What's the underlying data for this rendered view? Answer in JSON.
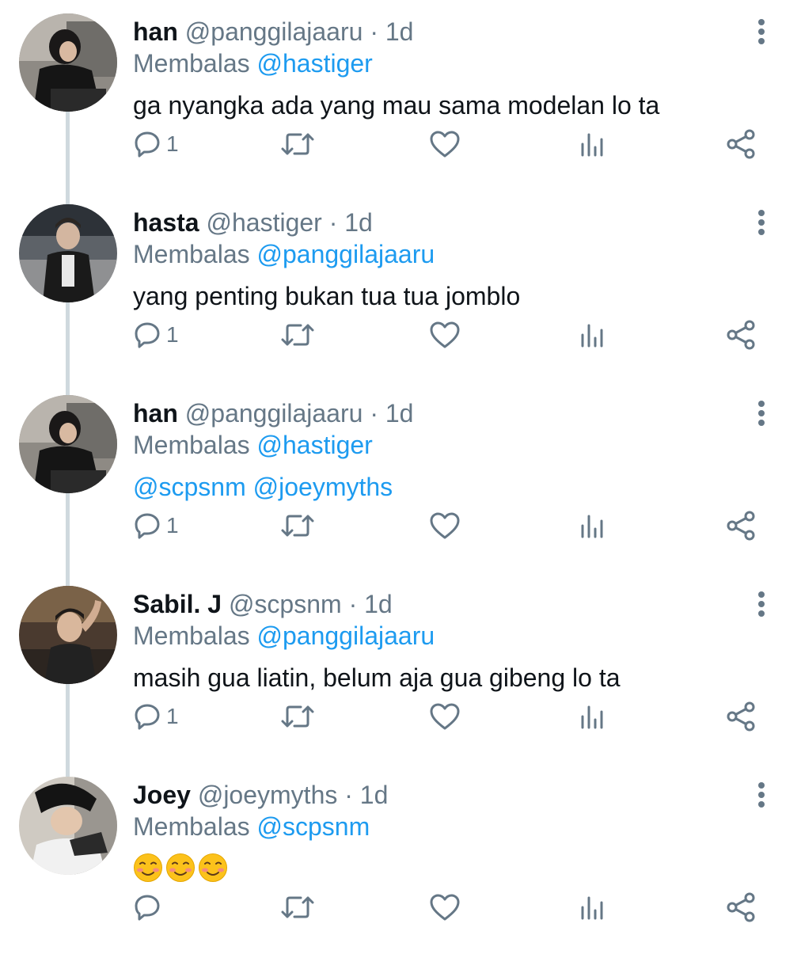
{
  "thread": {
    "replying_prefix": "Membalas",
    "tweets": [
      {
        "display_name": "han",
        "handle": "@panggilajaaru",
        "separator": "·",
        "time": "1d",
        "replying_to": "@hastiger",
        "text": "ga nyangka ada yang mau sama modelan lo ta",
        "reply_count": "1"
      },
      {
        "display_name": "hasta",
        "handle": "@hastiger",
        "separator": "·",
        "time": "1d",
        "replying_to": "@panggilajaaru",
        "text": "yang penting bukan tua tua jomblo",
        "reply_count": "1"
      },
      {
        "display_name": "han",
        "handle": "@panggilajaaru",
        "separator": "·",
        "time": "1d",
        "replying_to": "@hastiger",
        "text": "@scpsnm @joeymyths",
        "reply_count": "1"
      },
      {
        "display_name": "Sabil. J",
        "handle": "@scpsnm",
        "separator": "·",
        "time": "1d",
        "replying_to": "@panggilajaaru",
        "text": "masih gua liatin, belum aja gua gibeng lo ta",
        "reply_count": "1"
      },
      {
        "display_name": "Joey",
        "handle": "@joeymyths",
        "separator": "·",
        "time": "1d",
        "replying_to": "@scpsnm",
        "text": "☺☺☺",
        "reply_count": ""
      }
    ]
  },
  "icons": {
    "reply": "reply-icon",
    "retweet": "retweet-icon",
    "like": "heart-icon",
    "analytics": "analytics-icon",
    "share": "share-icon",
    "more": "more-vertical-icon",
    "emoji": "smiling-face-emoji-icon"
  },
  "colors": {
    "link": "#1d9bf0",
    "secondary_text": "#657786",
    "primary_text": "#0f1419",
    "thread_line": "#cfd9de"
  }
}
